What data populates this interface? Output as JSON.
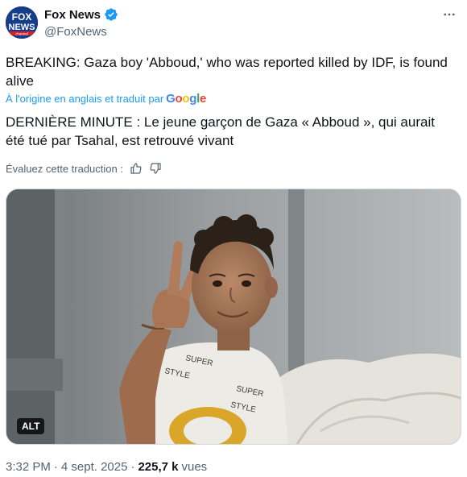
{
  "author": {
    "display_name": "Fox News",
    "handle": "@FoxNews",
    "verified": true,
    "avatar_text_top": "FOX",
    "avatar_text_bottom": "NEWS",
    "avatar_text_small": "channel"
  },
  "tweet": {
    "text": "BREAKING: Gaza boy 'Abboud,' who was reported killed by IDF, is found alive",
    "translation_credit": "À l'origine en anglais et traduit par",
    "google_logo": [
      "G",
      "o",
      "o",
      "g",
      "l",
      "e"
    ],
    "translated_text": "DERNIÈRE MINUTE : Le jeune garçon de Gaza « Abboud », qui aurait été tué par Tsahal, est retrouvé vivant",
    "rate_label": "Évaluez cette traduction :"
  },
  "media": {
    "alt_label": "ALT",
    "shirt_text_1": "SUPER",
    "shirt_text_2": "STYLE",
    "shirt_text_3": "SUPER",
    "shirt_text_4": "STYLE"
  },
  "meta": {
    "time": "3:32 PM",
    "separator": "·",
    "date": "4 sept. 2025",
    "views_count": "225,7 k",
    "views_label": "vues"
  },
  "colors": {
    "accent": "#1d9bf0",
    "text_primary": "#0f1419",
    "text_secondary": "#536471",
    "google": [
      "#4285F4",
      "#EA4335",
      "#FBBC05",
      "#4285F4",
      "#34A853",
      "#EA4335"
    ]
  },
  "icons": [
    "verified-badge-icon",
    "more-options-icon",
    "thumbs-up-icon",
    "thumbs-down-icon"
  ]
}
